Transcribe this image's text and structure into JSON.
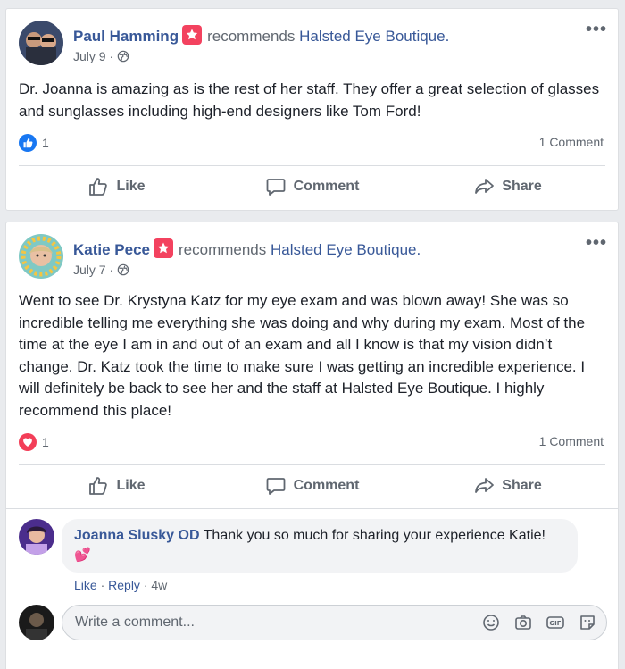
{
  "posts": [
    {
      "author": "Paul Hamming",
      "recommends_text": "recommends",
      "page_name": "Halsted Eye Boutique.",
      "date": "July 9 ·",
      "body": "Dr. Joanna is amazing as is the rest of her staff. They offer a great selection of glasses and sunglasses including high-end designers like Tom Ford!",
      "reaction_type": "like-icon",
      "reaction_count": "1",
      "comment_count": "1 Comment",
      "actions": {
        "like": "Like",
        "comment": "Comment",
        "share": "Share"
      }
    },
    {
      "author": "Katie Pece",
      "recommends_text": "recommends",
      "page_name": "Halsted Eye Boutique.",
      "date": "July 7 ·",
      "body": "Went to see Dr. Krystyna Katz for my eye exam and was blown away! She was so incredible telling me everything she was doing and why during my exam. Most of the time at the eye I am in and out of an exam and all I know is that my vision didn’t change. Dr. Katz took the time to make sure I was getting an incredible experience. I will definitely be back to see her and the staff at Halsted Eye Boutique. I highly recommend this place!",
      "reaction_type": "love-icon",
      "reaction_count": "1",
      "comment_count": "1 Comment",
      "actions": {
        "like": "Like",
        "comment": "Comment",
        "share": "Share"
      },
      "comment": {
        "author": "Joanna Slusky OD",
        "text": "Thank you so much for sharing your experience Katie!",
        "emoji": "💕",
        "like": "Like",
        "reply": "Reply",
        "time": "4w"
      },
      "write_comment_placeholder": "Write a comment..."
    }
  ],
  "colors": {
    "link": "#385898",
    "secondary": "#606770",
    "recommend_badge": "#f3425f",
    "like_blue": "#1877f2",
    "love_red": "#f33e58"
  }
}
